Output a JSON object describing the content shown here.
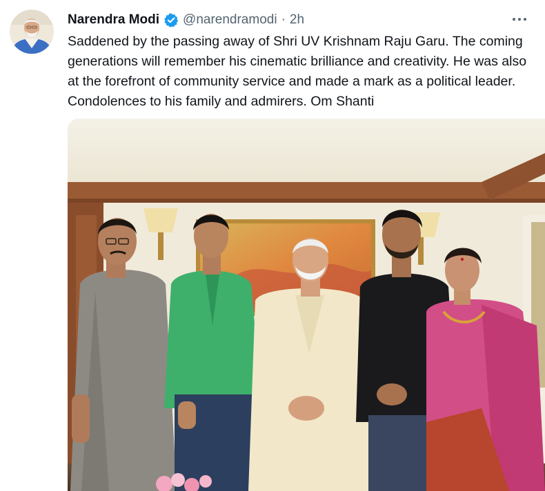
{
  "tweet": {
    "author": {
      "display_name": "Narendra Modi",
      "handle": "@narendramodi",
      "verified": true,
      "avatar_icon": "user-avatar"
    },
    "separator": "·",
    "time": "2h",
    "more_icon": "more-horizontal-icon",
    "text": "Saddened by the passing away of Shri UV Krishnam Raju Garu. The coming generations will remember his cinematic brilliance and creativity. He was also at the forefront of community service and made a mark as a political leader. Condolences to his family and admirers. Om Shanti",
    "media": {
      "type": "photo",
      "people_count": 5
    }
  },
  "colors": {
    "text_primary": "#0f1419",
    "text_secondary": "#536471",
    "verified_blue": "#1d9bf0"
  }
}
